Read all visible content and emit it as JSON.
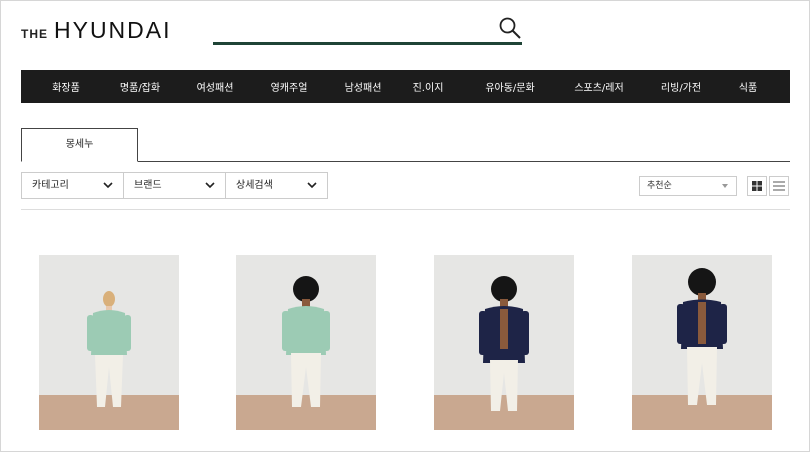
{
  "logo": {
    "prefix": "THE",
    "name": "HYUNDAI"
  },
  "search": {
    "placeholder": "",
    "icon": "search-icon"
  },
  "gnb": {
    "items": [
      {
        "label": "화장품"
      },
      {
        "label": "명품/잡화"
      },
      {
        "label": "여성패션"
      },
      {
        "label": "영캐주얼"
      },
      {
        "label": "남성패션"
      },
      {
        "label": "진.이지"
      },
      {
        "label": "유아동/문화"
      },
      {
        "label": "스포츠/레저"
      },
      {
        "label": "리빙/가전"
      },
      {
        "label": "식품"
      }
    ]
  },
  "tabs": [
    {
      "label": "몽세누"
    }
  ],
  "filters": [
    {
      "label": "카테고리"
    },
    {
      "label": "브랜드"
    },
    {
      "label": "상세검색"
    }
  ],
  "sort": {
    "selected": "추천순"
  },
  "view_modes": [
    "grid-view-icon",
    "list-view-icon"
  ],
  "products": [
    {
      "model": "blonde-woman",
      "jacket_color": "#9ccbb4"
    },
    {
      "model": "afro-man",
      "jacket_color": "#9ccbb4"
    },
    {
      "model": "afro-man",
      "jacket_color": "#1e2447"
    },
    {
      "model": "afro-man",
      "jacket_color": "#1e2447"
    }
  ],
  "colors": {
    "gnb_bg": "#1c1c1c",
    "search_underline": "#1f4436"
  }
}
